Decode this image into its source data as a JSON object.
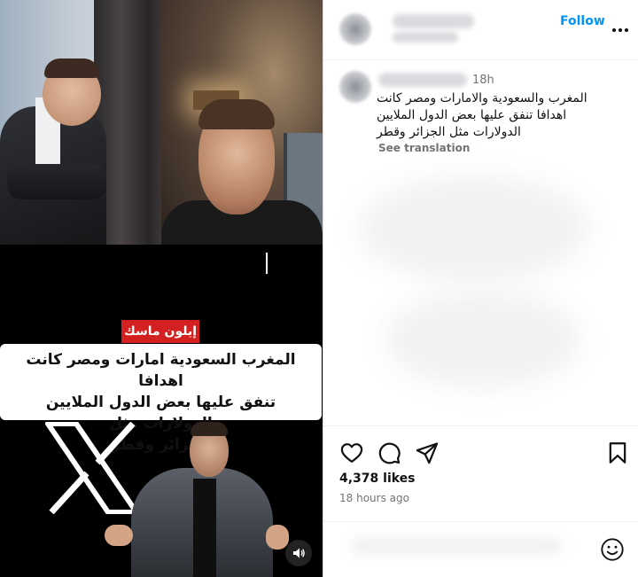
{
  "media": {
    "name_badge": "إيلون ماسك",
    "caption_line1": "المغرب السعودية امارات ومصر كانت اهدافا",
    "caption_line2": "تنفق عليها بعض الدول الملايين الدولارات مثل",
    "caption_line3": "الجزائر وقطر",
    "icons": [
      "x-logo",
      "volume-icon"
    ]
  },
  "header": {
    "follow_label": "Follow",
    "icons": [
      "avatar",
      "more-options-icon"
    ]
  },
  "comment": {
    "time_ago": "18h",
    "text_line1": "المغرب والسعودية والامارات ومصر كانت",
    "text_line2": "اهدافا تنفق عليها بعض الدول الملايين",
    "text_line3": "الدولارات مثل الجزائر وقطر",
    "see_translation": "See translation"
  },
  "actions": {
    "icons": [
      "heart-icon",
      "comment-icon",
      "share-icon",
      "bookmark-icon",
      "emoji-icon"
    ]
  },
  "stats": {
    "likes": "4,378 likes",
    "posted": "18 hours ago"
  },
  "colors": {
    "accent": "#0095f6",
    "badge": "#d32020",
    "secondary_text": "#737373"
  }
}
